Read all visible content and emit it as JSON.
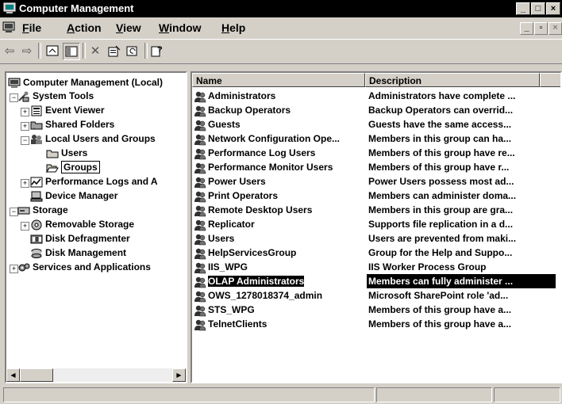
{
  "window": {
    "title": "Computer Management"
  },
  "menu": {
    "items": [
      {
        "label": "File",
        "accel": "F",
        "rest": "ile"
      },
      {
        "label": "Action",
        "accel": "A",
        "rest": "ction"
      },
      {
        "label": "View",
        "accel": "V",
        "rest": "iew"
      },
      {
        "label": "Window",
        "accel": "W",
        "rest": "indow"
      },
      {
        "label": "Help",
        "accel": "H",
        "rest": "elp"
      }
    ]
  },
  "tree": {
    "items": [
      {
        "label": "Computer Management (Local)",
        "icon": "computer-icon"
      },
      {
        "label": "System Tools",
        "icon": "tools-icon"
      },
      {
        "label": "Event Viewer",
        "icon": "event-viewer-icon"
      },
      {
        "label": "Shared Folders",
        "icon": "shared-folders-icon"
      },
      {
        "label": "Local Users and Groups",
        "icon": "users-groups-icon"
      },
      {
        "label": "Users",
        "icon": "folder-icon"
      },
      {
        "label": "Groups",
        "icon": "folder-open-icon"
      },
      {
        "label": "Performance Logs and A",
        "icon": "performance-logs-icon"
      },
      {
        "label": "Device Manager",
        "icon": "device-manager-icon"
      },
      {
        "label": "Storage",
        "icon": "storage-icon"
      },
      {
        "label": "Removable Storage",
        "icon": "removable-storage-icon"
      },
      {
        "label": "Disk Defragmenter",
        "icon": "defragmenter-icon"
      },
      {
        "label": "Disk Management",
        "icon": "disk-management-icon"
      },
      {
        "label": "Services and Applications",
        "icon": "services-icon"
      }
    ]
  },
  "list": {
    "columns": {
      "name": "Name",
      "description": "Description"
    },
    "rows": [
      {
        "name": "Administrators",
        "description": "Administrators have complete ..."
      },
      {
        "name": "Backup Operators",
        "description": "Backup Operators can overrid..."
      },
      {
        "name": "Guests",
        "description": "Guests have the same access..."
      },
      {
        "name": "Network Configuration Ope...",
        "description": "Members in this group can ha..."
      },
      {
        "name": "Performance Log Users",
        "description": "Members of this group have re..."
      },
      {
        "name": "Performance Monitor Users",
        "description": "Members of this group have r..."
      },
      {
        "name": "Power Users",
        "description": "Power Users possess most ad..."
      },
      {
        "name": "Print Operators",
        "description": "Members can administer doma..."
      },
      {
        "name": "Remote Desktop Users",
        "description": "Members in this group are gra..."
      },
      {
        "name": "Replicator",
        "description": "Supports file replication in a d..."
      },
      {
        "name": "Users",
        "description": "Users are prevented from maki..."
      },
      {
        "name": "HelpServicesGroup",
        "description": "Group for the Help and Suppo..."
      },
      {
        "name": "IIS_WPG",
        "description": "IIS Worker Process Group"
      },
      {
        "name": "OLAP Administrators",
        "description": "Members can fully administer ..."
      },
      {
        "name": "OWS_1278018374_admin",
        "description": "Microsoft SharePoint role 'ad..."
      },
      {
        "name": "STS_WPG",
        "description": "Members of this group have a..."
      },
      {
        "name": "TelnetClients",
        "description": "Members of this group have a..."
      }
    ],
    "selected_row": "OLAP Administrators"
  },
  "colors": {
    "selection": "#000000",
    "chrome": "#d4d0c8"
  }
}
